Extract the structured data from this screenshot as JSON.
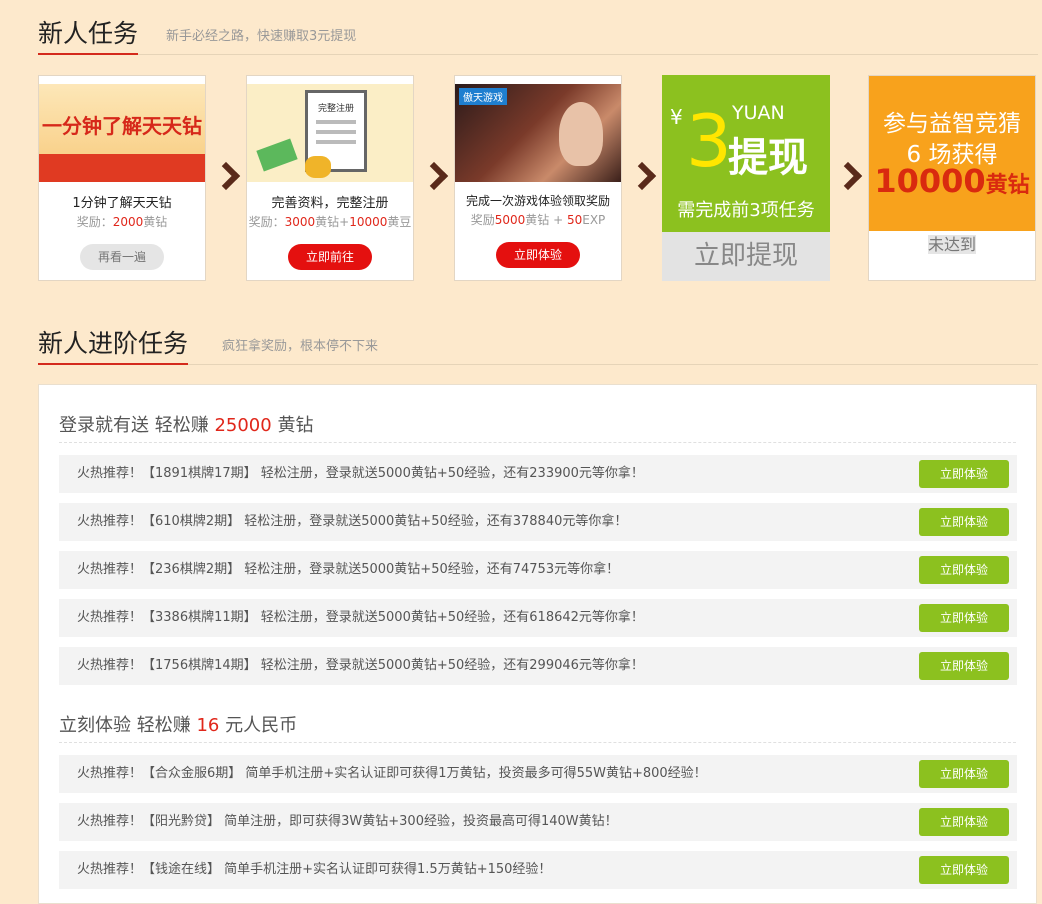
{
  "section1": {
    "title": "新人任务",
    "subtitle": "新手必经之路，快速赚取3元提现"
  },
  "tasks": [
    {
      "banner": "一分钟了解天天钻",
      "name": "1分钟了解天天钻",
      "reward_prefix": "奖励：",
      "reward_value": "2000",
      "reward_suffix": "黄钻",
      "button": "再看一遍"
    },
    {
      "banner": "完整注册",
      "name": "完善资料，完整注册",
      "reward_prefix": "奖励：",
      "reward_value": "3000",
      "reward_mid": "黄钻+",
      "reward_value2": "10000",
      "reward_suffix": "黄豆",
      "button": "立即前往"
    },
    {
      "banner": "傲天游戏",
      "name": "完成一次游戏体验领取奖励",
      "reward_prefix": "奖励",
      "reward_value": "5000",
      "reward_mid": "黄钻 + ",
      "reward_value2": "50",
      "reward_suffix": "EXP",
      "button": "立即体验"
    }
  ],
  "withdraw": {
    "currency": "¥",
    "unit": "YUAN",
    "amount": "3",
    "label": "提现",
    "note": "需完成前3项任务",
    "button": "立即提现"
  },
  "quiz": {
    "line1": "参与益智竞猜",
    "line2": "6 场获得",
    "amount": "10000",
    "unit": "黄钻",
    "button": "未达到"
  },
  "section2": {
    "title": "新人进阶任务",
    "subtitle": "疯狂拿奖励，根本停不下来"
  },
  "groups": [
    {
      "title_prefix": "登录就有送 轻松赚 ",
      "title_value": "25000",
      "title_suffix": " 黄钻",
      "rows": [
        {
          "text": "火热推荐！【1891棋牌17期】 轻松注册，登录就送5000黄钻+50经验，还有233900元等你拿！",
          "button": "立即体验"
        },
        {
          "text": "火热推荐！【610棋牌2期】 轻松注册，登录就送5000黄钻+50经验，还有378840元等你拿！",
          "button": "立即体验"
        },
        {
          "text": "火热推荐！【236棋牌2期】 轻松注册，登录就送5000黄钻+50经验，还有74753元等你拿！",
          "button": "立即体验"
        },
        {
          "text": "火热推荐！【3386棋牌11期】 轻松注册，登录就送5000黄钻+50经验，还有618642元等你拿！",
          "button": "立即体验"
        },
        {
          "text": "火热推荐！【1756棋牌14期】 轻松注册，登录就送5000黄钻+50经验，还有299046元等你拿！",
          "button": "立即体验"
        }
      ]
    },
    {
      "title_prefix": "立刻体验 轻松赚 ",
      "title_value": "16",
      "title_suffix": " 元人民币",
      "rows": [
        {
          "text": "火热推荐！【合众金服6期】 简单手机注册+实名认证即可获得1万黄钻，投资最多可得55W黄钻+800经验！",
          "button": "立即体验"
        },
        {
          "text": "火热推荐！【阳光黔贷】 简单注册，即可获得3W黄钻+300经验，投资最高可得140W黄钻！",
          "button": "立即体验"
        },
        {
          "text": "火热推荐！【钱途在线】 简单手机注册+实名认证即可获得1.5万黄钻+150经验！",
          "button": "立即体验"
        }
      ]
    }
  ]
}
